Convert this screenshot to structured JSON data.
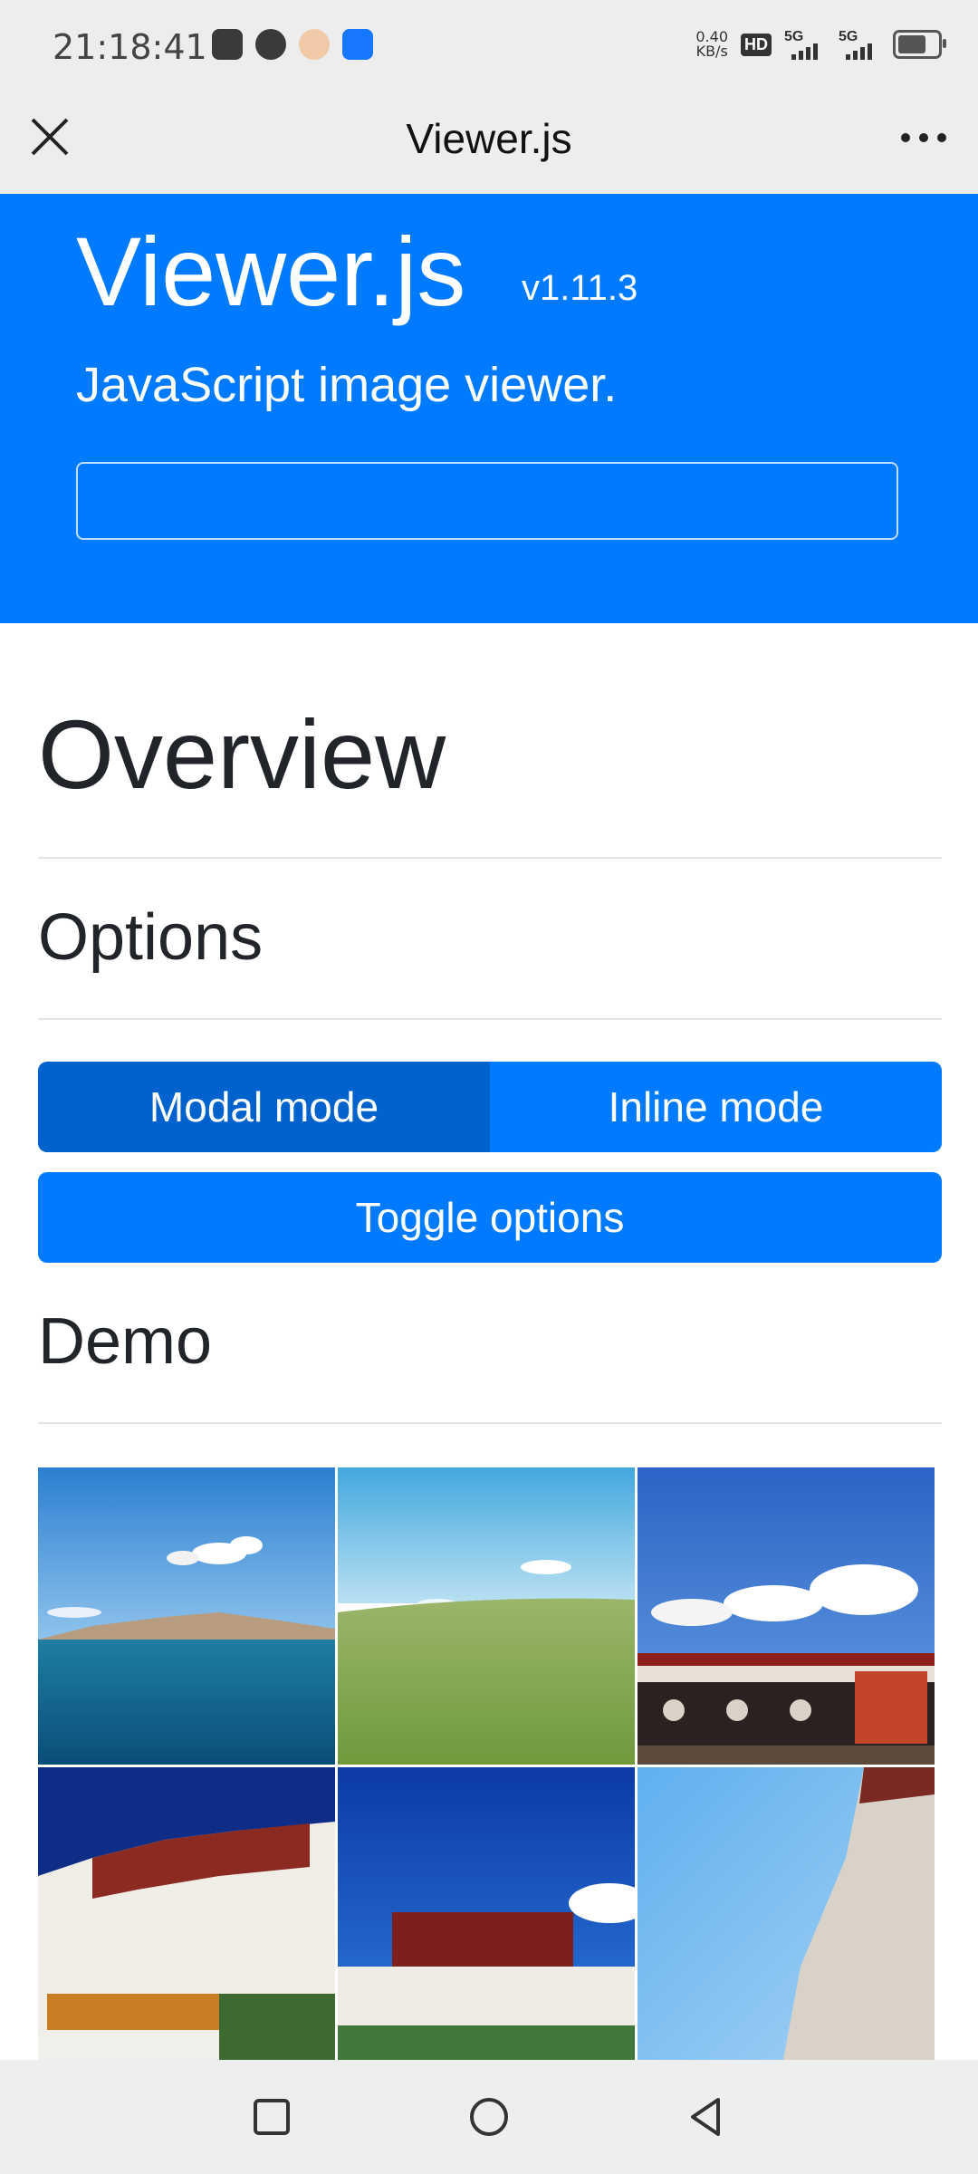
{
  "status_bar": {
    "time": "21:18:41",
    "net_speed_value": "0.40",
    "net_speed_unit": "KB/s",
    "hd_label": "HD",
    "sim1_label": "5G",
    "sim2_label": "5G"
  },
  "title_bar": {
    "title": "Viewer.js",
    "close_icon": "close-icon",
    "more_icon": "more-horizontal-icon"
  },
  "hero": {
    "title": "Viewer.js",
    "version": "v1.11.3",
    "subtitle": "JavaScript image viewer.",
    "input_value": ""
  },
  "content": {
    "overview_heading": "Overview",
    "options_heading": "Options",
    "modal_mode_label": "Modal mode",
    "inline_mode_label": "Inline mode",
    "toggle_options_label": "Toggle options",
    "demo_heading": "Demo"
  },
  "gallery": {
    "images": [
      "lake-and-mountains",
      "green-grassland",
      "temple-courtyard",
      "potala-palace",
      "potala-palace-wide",
      "palace-wall-sky"
    ]
  },
  "nav_bar": {
    "icons": [
      "recent-apps-icon",
      "home-icon",
      "back-icon"
    ]
  },
  "colors": {
    "primary": "#007bff",
    "primary_active": "#0062cc",
    "chrome": "#ededed"
  }
}
